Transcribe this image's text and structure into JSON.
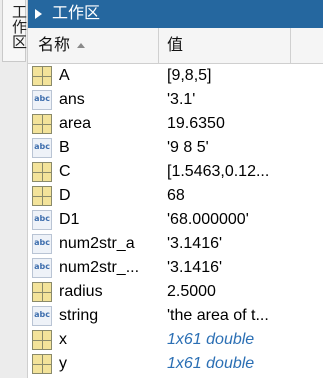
{
  "side_tab": {
    "label": "工作区"
  },
  "titlebar": {
    "title": "工作区"
  },
  "columns": {
    "name_label": "名称",
    "value_label": "值"
  },
  "variables": [
    {
      "icon": "matrix-icon",
      "name": "A",
      "value": "[9,8,5]",
      "italic": false
    },
    {
      "icon": "char-icon",
      "name": "ans",
      "value": "'3.1'",
      "italic": false
    },
    {
      "icon": "matrix-icon",
      "name": "area",
      "value": "19.6350",
      "italic": false
    },
    {
      "icon": "char-icon",
      "name": "B",
      "value": "'9  8  5'",
      "italic": false
    },
    {
      "icon": "matrix-icon",
      "name": "C",
      "value": "[1.5463,0.12...",
      "italic": false
    },
    {
      "icon": "matrix-icon",
      "name": "D",
      "value": "68",
      "italic": false
    },
    {
      "icon": "char-icon",
      "name": "D1",
      "value": "'68.000000'",
      "italic": false
    },
    {
      "icon": "char-icon",
      "name": "num2str_a",
      "value": "'3.1416'",
      "italic": false
    },
    {
      "icon": "char-icon",
      "name": "num2str_...",
      "value": "'3.1416'",
      "italic": false
    },
    {
      "icon": "matrix-icon",
      "name": "radius",
      "value": "2.5000",
      "italic": false
    },
    {
      "icon": "char-icon",
      "name": "string",
      "value": "'the area of t...",
      "italic": false
    },
    {
      "icon": "matrix-icon",
      "name": "x",
      "value": "1x61 double",
      "italic": true
    },
    {
      "icon": "matrix-icon",
      "name": "y",
      "value": "1x61 double",
      "italic": true
    }
  ],
  "colors": {
    "titlebar": "#25679f",
    "italic_value": "#2b6fb4",
    "matrix_icon_fill": "#f3e39a",
    "char_icon_text": "#3f6fae"
  },
  "icon_text": {
    "char": "abc"
  }
}
